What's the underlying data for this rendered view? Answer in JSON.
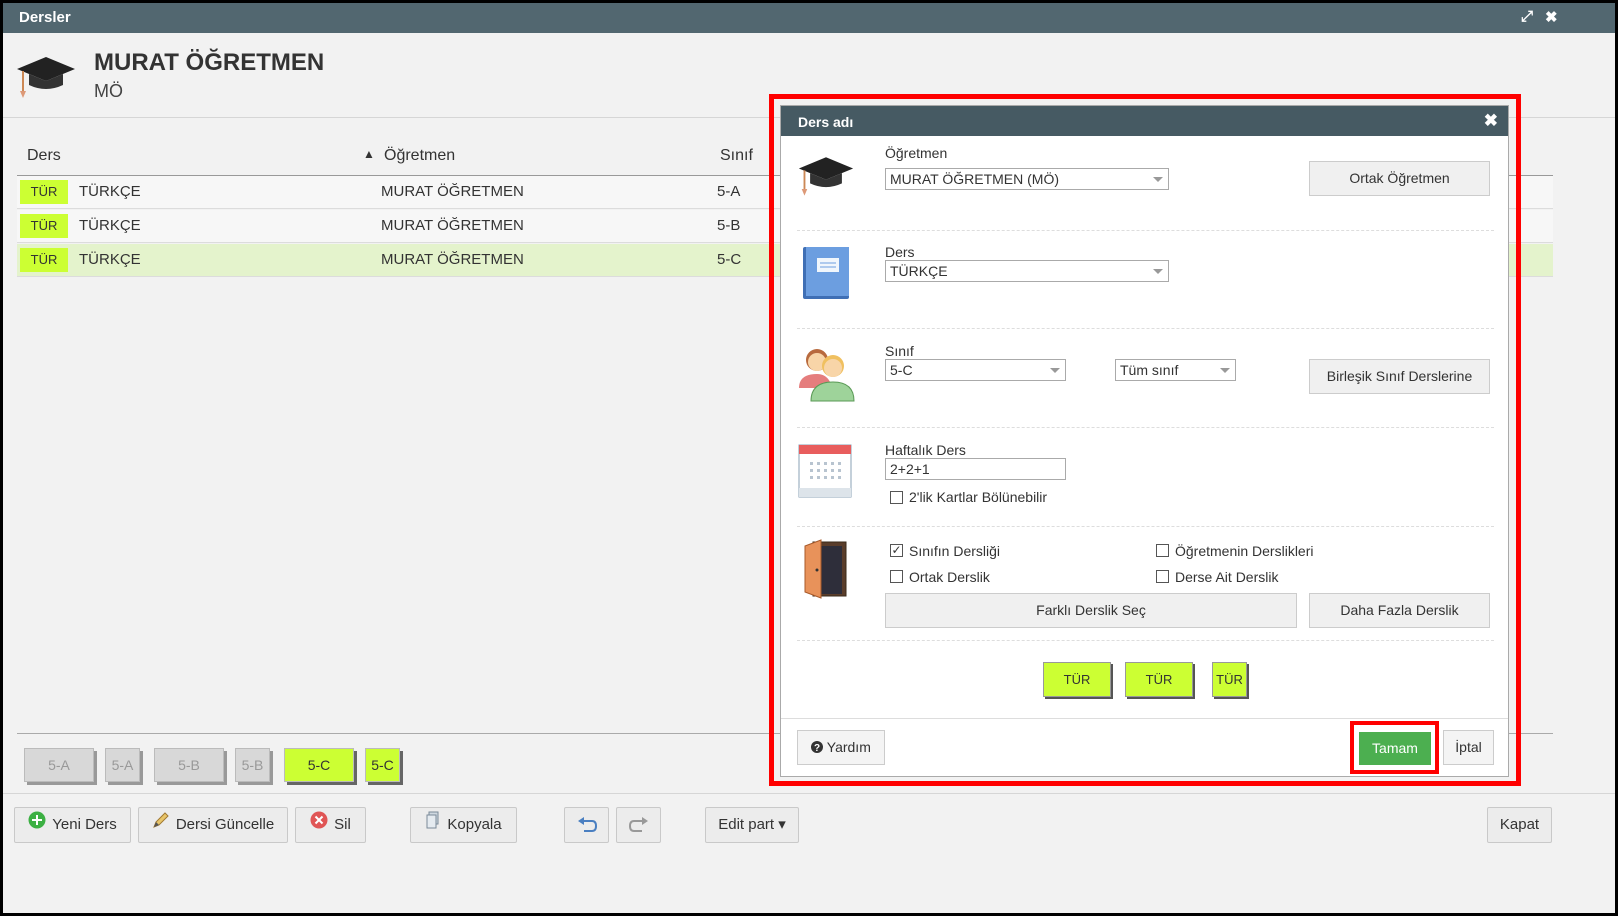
{
  "window": {
    "title": "Dersler"
  },
  "teacher": {
    "name": "MURAT ÖĞRETMEN",
    "short": "MÖ"
  },
  "table": {
    "headers": {
      "ders": "Ders",
      "sort_arrow": "▲",
      "ogretmen": "Öğretmen",
      "sinif": "Sınıf"
    },
    "rows": [
      {
        "badge": "TÜR",
        "ders": "TÜRKÇE",
        "ogretmen": "MURAT ÖĞRETMEN",
        "sinif": "5-A"
      },
      {
        "badge": "TÜR",
        "ders": "TÜRKÇE",
        "ogretmen": "MURAT ÖĞRETMEN",
        "sinif": "5-B"
      },
      {
        "badge": "TÜR",
        "ders": "TÜRKÇE",
        "ogretmen": "MURAT ÖĞRETMEN",
        "sinif": "5-C"
      }
    ]
  },
  "class_buttons": [
    "5-A",
    "5-A",
    "5-B",
    "5-B",
    "5-C",
    "5-C"
  ],
  "toolbar": {
    "new": "Yeni Ders",
    "update": "Dersi Güncelle",
    "delete": "Sil",
    "copy": "Kopyala",
    "edit_part": "Edit part ▾",
    "close": "Kapat"
  },
  "dialog": {
    "title": "Ders adı",
    "teacher_label": "Öğretmen",
    "teacher_value": "MURAT ÖĞRETMEN (MÖ)",
    "shared_teacher_btn": "Ortak Öğretmen",
    "lesson_label": "Ders",
    "lesson_value": "TÜRKÇE",
    "class_label": "Sınıf",
    "class_value": "5-C",
    "group_value": "Tüm sınıf",
    "merged_btn": "Birleşik Sınıf Derslerine",
    "weekly_label": "Haftalık Ders",
    "weekly_value": "2+2+1",
    "split_label": "2'lik Kartlar Bölünebilir",
    "room_opts": {
      "class_room": "Sınıfın Dersliği",
      "teacher_rooms": "Öğretmenin Derslikleri",
      "shared_room": "Ortak Derslik",
      "lesson_room": "Derse Ait Derslik"
    },
    "other_room_btn": "Farklı Derslik Seç",
    "more_rooms_btn": "Daha Fazla Derslik",
    "cards": [
      "TÜR",
      "TÜR",
      "TÜR"
    ],
    "help": "Yardım",
    "ok": "Tamam",
    "cancel": "İptal"
  },
  "colors": {
    "titlebar": "#526770",
    "lesson_badge": "#ccff33",
    "ok_button": "#4caf50",
    "highlight": "#ff0000"
  }
}
